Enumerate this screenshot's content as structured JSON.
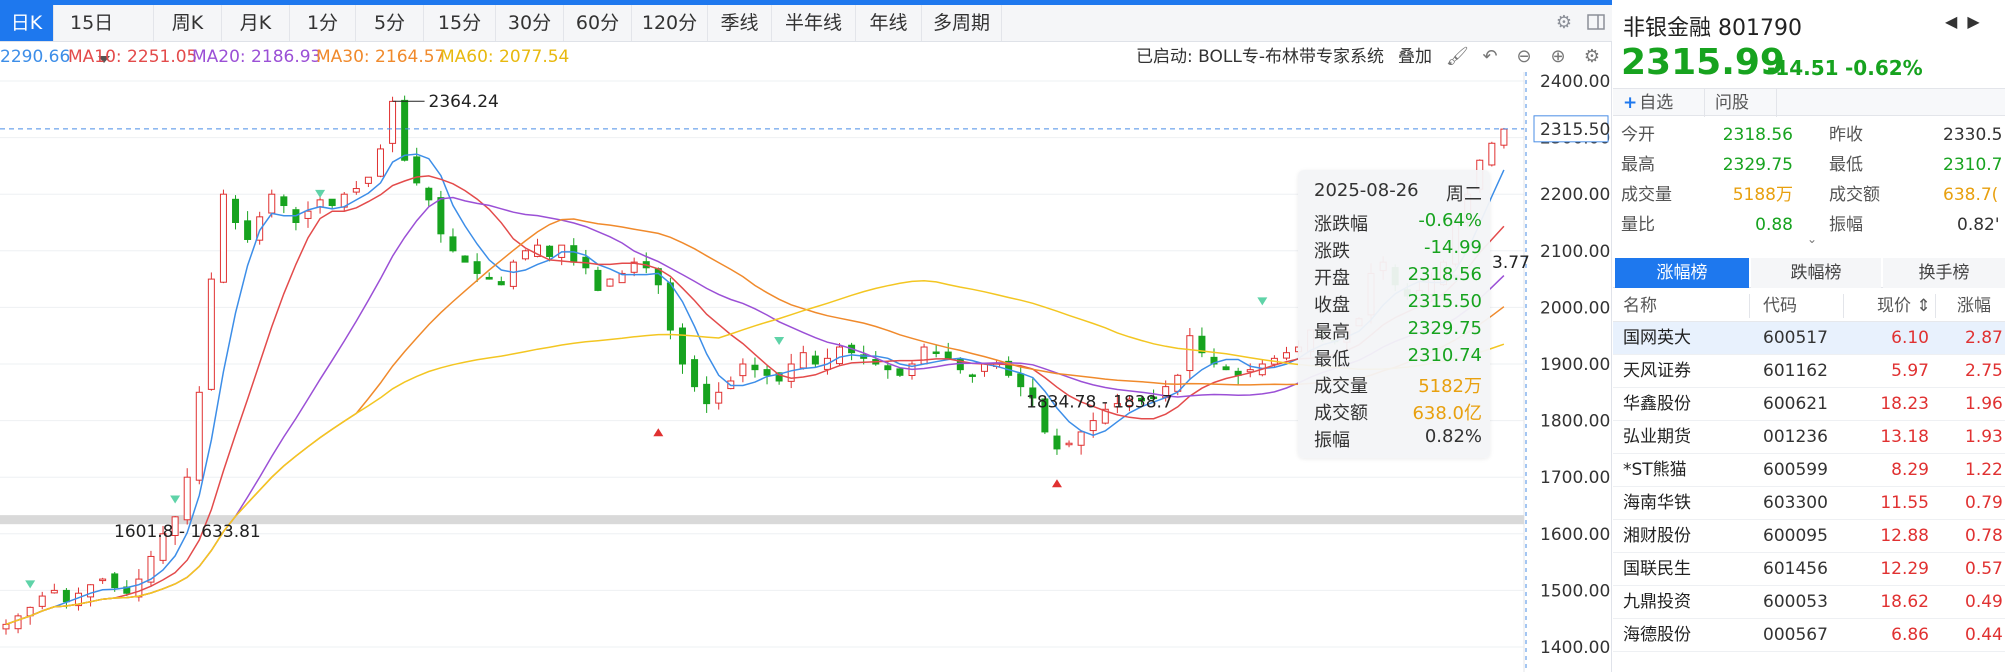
{
  "toolbar": {
    "tabs": [
      "日K",
      "15日",
      "周K",
      "月K",
      "1分",
      "5分",
      "15分",
      "30分",
      "60分",
      "120分",
      "季线",
      "半年线",
      "年线",
      "多周期"
    ]
  },
  "ma_legend": {
    "ma5": "2290.66",
    "ma10": "MA10: 2251.05",
    "ma20": "MA20: 2186.93",
    "ma30": "MA30: 2164.57",
    "ma60": "MA60: 2077.54"
  },
  "status": {
    "started": "已启动: BOLL专-布林带专家系统",
    "overlay": "叠加"
  },
  "colors": {
    "ma5": "#3d8ee8",
    "ma10": "#e34b4b",
    "ma20": "#9b50d6",
    "ma30": "#f08a2c",
    "ma60": "#f3c622",
    "up": "#e03131",
    "down": "#17a31f",
    "accent": "#1e78ee"
  },
  "chart_data": {
    "type": "candlestick",
    "y_axis_ticks": [
      "2400.00",
      "2300.00",
      "2200.00",
      "2100.00",
      "2000.00",
      "1900.00",
      "1800.00",
      "1700.00",
      "1600.00",
      "1500.00",
      "1400.00"
    ],
    "ylim": [
      1400,
      2400
    ],
    "current_price_label": "2315.50",
    "current_price": 2315.5,
    "annotations": {
      "high": "2364.24",
      "low_range_1": "1834.78 - 1838.7",
      "low_range_2": "1601.8 - 1633.81",
      "partial": "3.77"
    },
    "support_band": [
      1617,
      1633
    ],
    "approx_closes": [
      1440,
      1455,
      1470,
      1490,
      1500,
      1480,
      1495,
      1510,
      1520,
      1505,
      1495,
      1520,
      1560,
      1600,
      1630,
      1700,
      1850,
      2050,
      2200,
      2150,
      2120,
      2160,
      2200,
      2180,
      2150,
      2170,
      2190,
      2180,
      2200,
      2210,
      2230,
      2280,
      2364,
      2260,
      2220,
      2190,
      2130,
      2100,
      2080,
      2060,
      2050,
      2040,
      2080,
      2100,
      2110,
      2090,
      2110,
      2080,
      2070,
      2030,
      2050,
      2060,
      2080,
      2070,
      2040,
      1960,
      1900,
      1860,
      1830,
      1850,
      1870,
      1900,
      1890,
      1880,
      1870,
      1900,
      1920,
      1900,
      1910,
      1930,
      1920,
      1910,
      1900,
      1890,
      1880,
      1900,
      1930,
      1920,
      1910,
      1890,
      1880,
      1900,
      1900,
      1880,
      1860,
      1840,
      1780,
      1750,
      1760,
      1780,
      1800,
      1820,
      1830,
      1838,
      1835,
      1840,
      1860,
      1880,
      1950,
      1920,
      1900,
      1890,
      1880,
      1890,
      1900,
      1910,
      1920,
      1930,
      1960,
      1950,
      1940,
      1960,
      1980,
      2060,
      2080,
      2040,
      2020,
      2030,
      2050,
      2080,
      2150,
      2200,
      2260,
      2290,
      2315
    ]
  },
  "tooltip": {
    "date": "2025-08-26",
    "weekday": "周二",
    "rows": [
      {
        "label": "涨跌幅",
        "value": "-0.64%"
      },
      {
        "label": "涨跌",
        "value": "-14.99"
      },
      {
        "label": "开盘",
        "value": "2318.56"
      },
      {
        "label": "收盘",
        "value": "2315.50"
      },
      {
        "label": "最高",
        "value": "2329.75"
      },
      {
        "label": "最低",
        "value": "2310.74"
      },
      {
        "label": "成交量",
        "value": "5182万"
      },
      {
        "label": "成交额",
        "value": "638.0亿"
      },
      {
        "label": "振幅",
        "value": "0.82%"
      }
    ]
  },
  "side": {
    "name": "非银金融 801790",
    "price": "2315.99",
    "change": "-14.51",
    "change_pct": "-0.62%",
    "buttons": [
      "自选",
      "问股"
    ],
    "quote": [
      {
        "l1": "今开",
        "v1": "2318.56",
        "l2": "昨收",
        "v2": "2330.5"
      },
      {
        "l1": "最高",
        "v1": "2329.75",
        "l2": "最低",
        "v2": "2310.7"
      },
      {
        "l1": "成交量",
        "v1": "5188万",
        "l2": "成交额",
        "v2": "638.7("
      },
      {
        "l1": "量比",
        "v1": "0.88",
        "l2": "振幅",
        "v2": "0.82'"
      }
    ],
    "rank_tabs": [
      "涨幅榜",
      "跌幅榜",
      "换手榜"
    ],
    "columns": [
      "名称",
      "代码",
      "现价 ⇕",
      "涨幅"
    ],
    "rows": [
      {
        "name": "国网英大",
        "code": "600517",
        "price": "6.10",
        "pct": "2.87"
      },
      {
        "name": "天风证券",
        "code": "601162",
        "price": "5.97",
        "pct": "2.75"
      },
      {
        "name": "华鑫股份",
        "code": "600621",
        "price": "18.23",
        "pct": "1.96"
      },
      {
        "name": "弘业期货",
        "code": "001236",
        "price": "13.18",
        "pct": "1.93"
      },
      {
        "name": "*ST熊猫",
        "code": "600599",
        "price": "8.29",
        "pct": "1.22"
      },
      {
        "name": "海南华铁",
        "code": "603300",
        "price": "11.55",
        "pct": "0.79"
      },
      {
        "name": "湘财股份",
        "code": "600095",
        "price": "12.88",
        "pct": "0.78"
      },
      {
        "name": "国联民生",
        "code": "601456",
        "price": "12.29",
        "pct": "0.57"
      },
      {
        "name": "九鼎投资",
        "code": "600053",
        "price": "18.62",
        "pct": "0.49"
      },
      {
        "name": "海德股份",
        "code": "000567",
        "price": "6.86",
        "pct": "0.44"
      }
    ]
  }
}
